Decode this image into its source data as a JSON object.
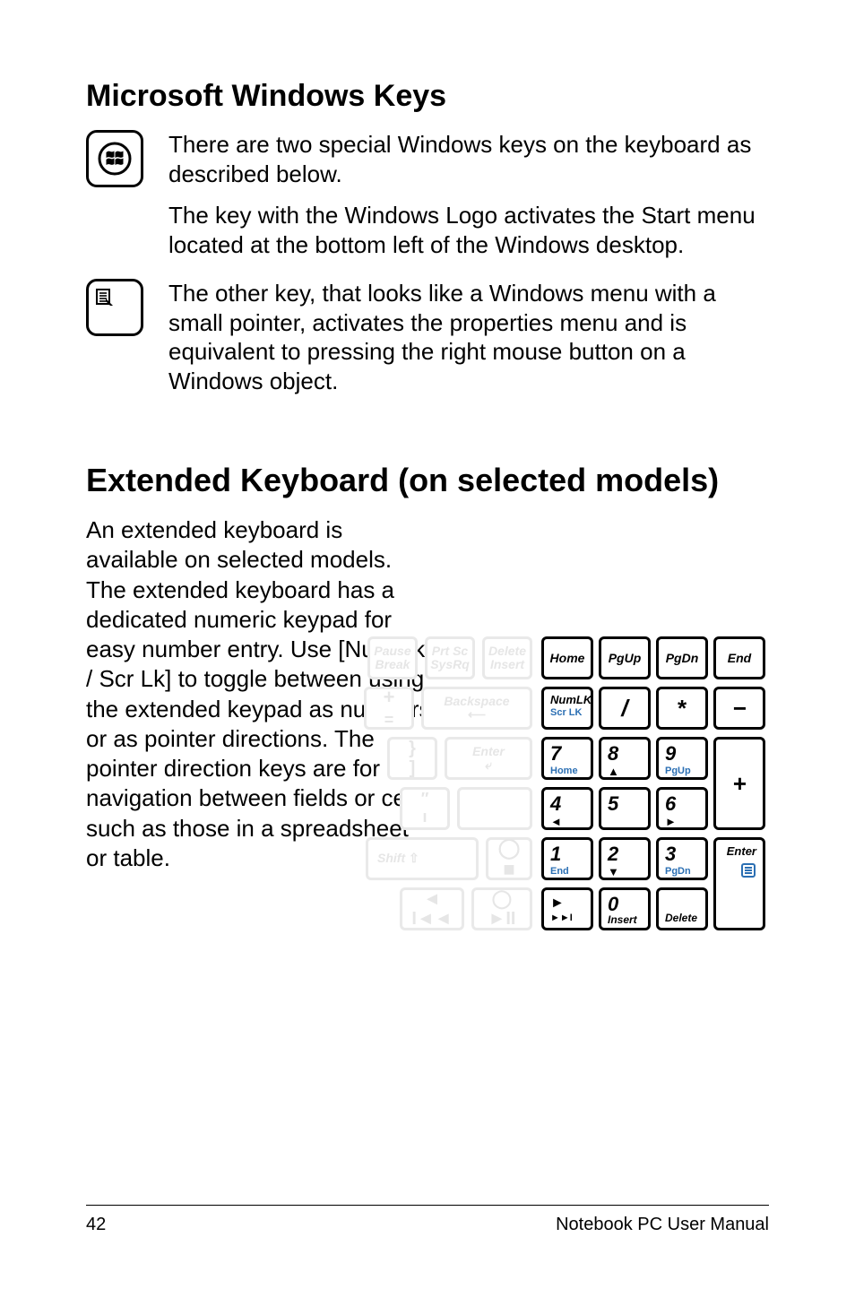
{
  "section1": {
    "title": "Microsoft Windows Keys",
    "p1": "There are two special Windows keys on the keyboard as described below.",
    "p2": "The key with the Windows Logo activates the Start menu located at the bottom left of the Windows desktop.",
    "p3": "The other key, that looks like a Windows menu with a small pointer, activates the properties menu and is equivalent to pressing the right mouse button on a Windows object."
  },
  "section2": {
    "title": "Extended Keyboard (on selected models)",
    "body": "An extended keyboard is available on selected models. The extended keyboard has a dedicated numeric keypad for easy number entry. Use [Num Lk / Scr Lk] to toggle between using the extended keypad as numbers or as pointer directions. The pointer direction keys are for navigation between fields or cells such as those in a spreadsheet or table."
  },
  "ghostkeys": {
    "pause": "Pause\nBreak",
    "prtsc": "Prt Sc\nSysRq",
    "delete": "Delete\nInsert",
    "backspace": "Backspace",
    "enter": "Enter",
    "shift": "Shift"
  },
  "numpad": {
    "r0": [
      "Home",
      "PgUp",
      "PgDn",
      "End"
    ],
    "numlk": {
      "top": "NumLK",
      "bot": "Scr LK"
    },
    "slash": "/",
    "star": "*",
    "minus": "−",
    "plus": "+",
    "k7": {
      "n": "7",
      "s": "Home"
    },
    "k8": {
      "n": "8",
      "a": "▲"
    },
    "k9": {
      "n": "9",
      "s": "PgUp"
    },
    "k4": {
      "n": "4",
      "a": "◄"
    },
    "k5": {
      "n": "5"
    },
    "k6": {
      "n": "6",
      "a": "►"
    },
    "k1": {
      "n": "1",
      "s": "End"
    },
    "k2": {
      "n": "2",
      "a": "▼"
    },
    "k3": {
      "n": "3",
      "s": "PgDn"
    },
    "k0": {
      "n": "0",
      "s": "Insert"
    },
    "kdel": {
      "s": "Delete"
    },
    "enter": "Enter",
    "play": "►",
    "next": "►►I"
  },
  "footer": {
    "page": "42",
    "label": "Notebook PC User Manual"
  }
}
